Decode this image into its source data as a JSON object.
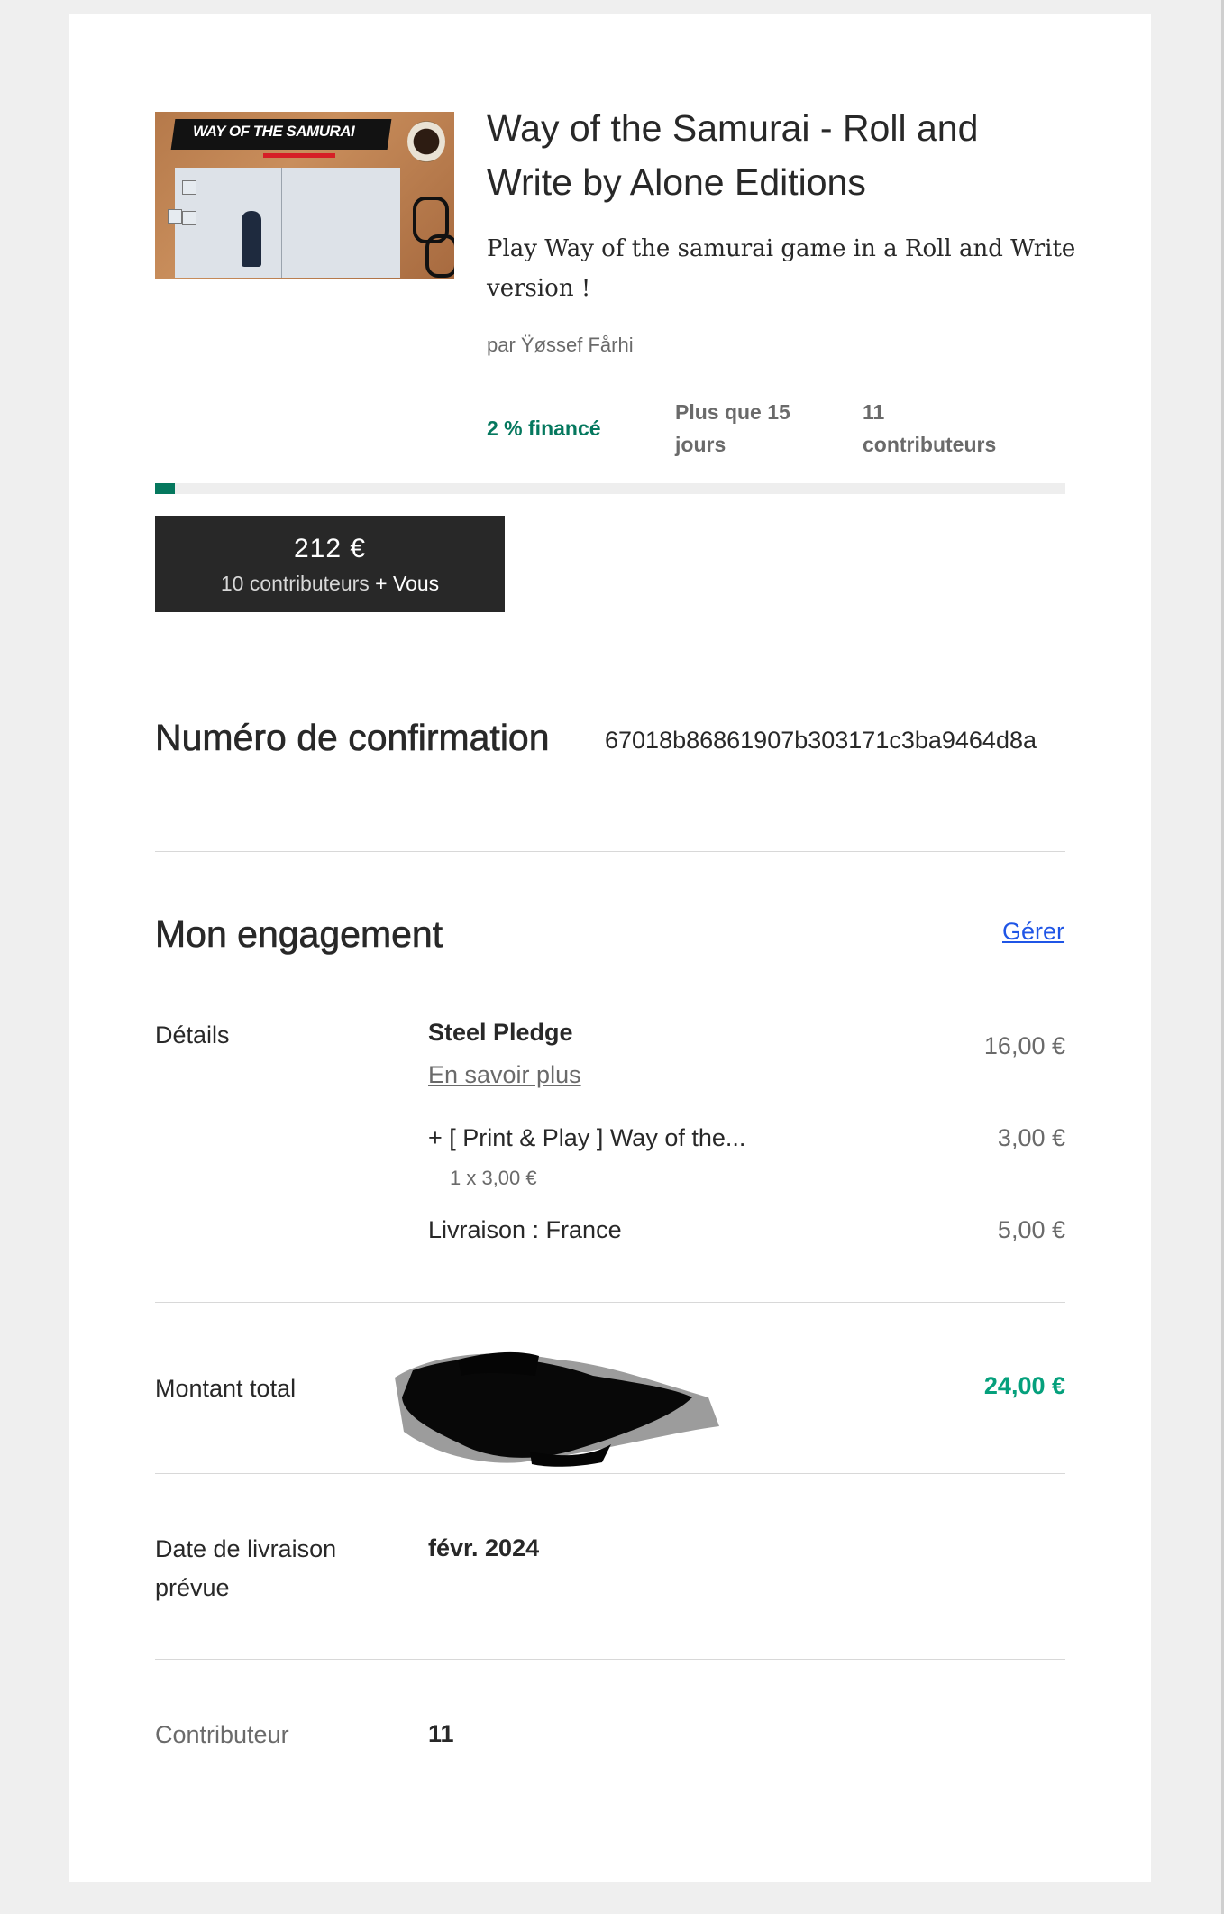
{
  "project": {
    "image_alt_text": "WAY OF THE SAMURAI",
    "title": "Way of the Samurai - Roll and Write by Alone Editions",
    "description": "Play Way of the samurai game in a Roll and Write version !",
    "creator": "par Ÿøssef Fårhi",
    "stats": {
      "funded": "2 % financé",
      "time_left_line1": "Plus que 15",
      "time_left_line2": "jours",
      "backers_line1": "11",
      "backers_line2": "contributeurs"
    },
    "progress_fraction": 0.02
  },
  "pledge_box": {
    "amount": "212 €",
    "backers": "10 contributeurs",
    "plus_you": "+ Vous"
  },
  "confirmation": {
    "heading": "Numéro de confirmation",
    "number": "67018b86861907b303171c3ba9464d8a"
  },
  "engagement": {
    "heading": "Mon engagement",
    "manage_label": "Gérer",
    "details_label": "Détails",
    "reward_name": "Steel Pledge",
    "reward_price": "16,00 €",
    "learn_more": "En savoir plus",
    "addon_name": "+ [ Print & Play ] Way of the...",
    "addon_price": "3,00 €",
    "addon_qty": "1 x 3,00 €",
    "shipping_label": "Livraison : France",
    "shipping_price": "5,00 €"
  },
  "total": {
    "label": "Montant total",
    "amount": "24,00 €"
  },
  "delivery": {
    "label_line1": "Date de livraison",
    "label_line2": "prévue",
    "value": "févr. 2024"
  },
  "backer": {
    "label": "Contributeur",
    "value": "11"
  },
  "colors": {
    "accent_green": "#05785e",
    "total_green": "#05a07c",
    "link_blue": "#1f55e6",
    "dark_box": "#282828"
  }
}
